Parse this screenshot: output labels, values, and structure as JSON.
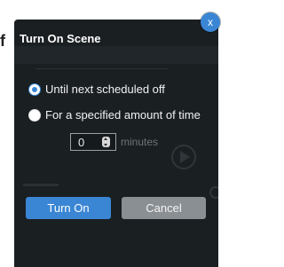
{
  "behind": {
    "fragment": "f"
  },
  "dialog": {
    "title": "Turn On Scene",
    "close_glyph": "x",
    "options": [
      {
        "label": "Until next scheduled off",
        "selected": true
      },
      {
        "label": "For a specified amount of time",
        "selected": false
      }
    ],
    "duration": {
      "value": "0",
      "unit_label": "minutes"
    },
    "buttons": {
      "confirm": "Turn On",
      "cancel": "Cancel"
    }
  },
  "colors": {
    "accent": "#3a86d4",
    "dialog_bg": "#1a1f22",
    "secondary_button": "#8a8f93"
  },
  "icons": [
    "close-icon",
    "stepper-icon",
    "play-icon",
    "gear-icon"
  ]
}
